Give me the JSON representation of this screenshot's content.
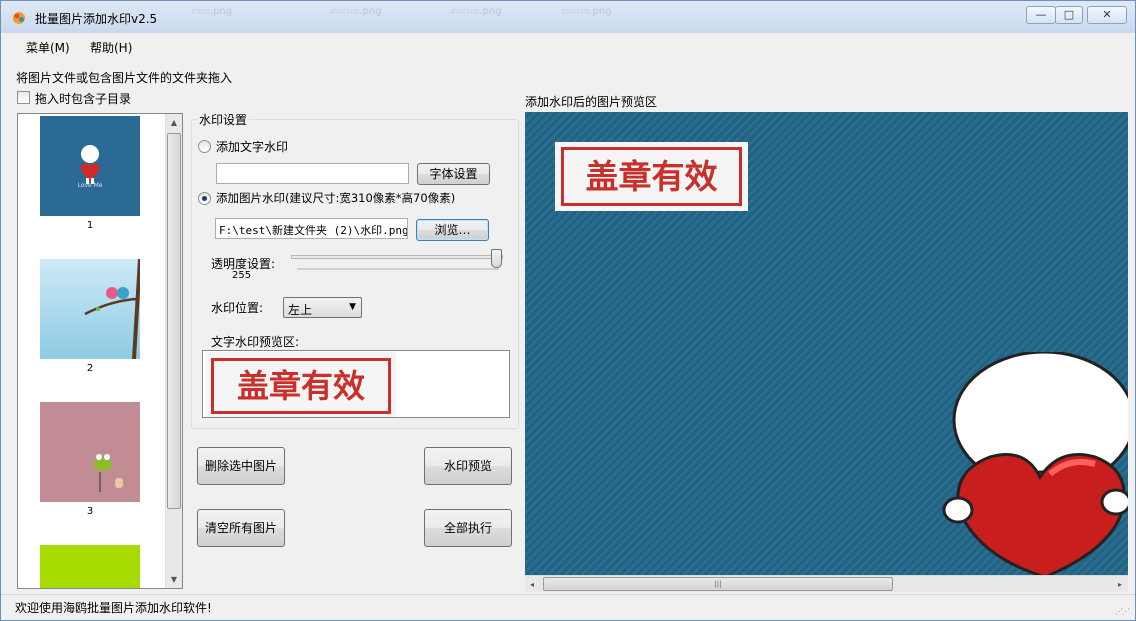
{
  "window": {
    "title": "批量图片添加水印v2.5",
    "controls": {
      "minimize": "—",
      "maximize": "□",
      "close": "✕"
    }
  },
  "menu": {
    "items": [
      "菜单(M)",
      "帮助(H)"
    ]
  },
  "left": {
    "drop_hint": "将图片文件或包含图片文件的文件夹拖入",
    "include_subdirs_label": "拖入时包含子目录",
    "include_subdirs_checked": false,
    "thumbnails": [
      {
        "number": "1",
        "caption": "Love Me",
        "bg": "#2a6a94"
      },
      {
        "number": "2",
        "bg": "#9fd3ea"
      },
      {
        "number": "3",
        "bg": "#c18c94"
      },
      {
        "number": "",
        "bg": "#a8dc00"
      }
    ]
  },
  "watermark_settings": {
    "group_title": "水印设置",
    "text_watermark_label": "添加文字水印",
    "text_watermark_checked": false,
    "text_input_value": "",
    "font_settings_button": "字体设置",
    "image_watermark_label": "添加图片水印(建议尺寸:宽310像素*高70像素)",
    "image_watermark_checked": true,
    "image_path": "F:\\test\\新建文件夹 (2)\\水印.png",
    "browse_button": "浏览…",
    "opacity_label": "透明度设置:",
    "opacity_value": "255",
    "opacity_max": "255",
    "position_label": "水印位置:",
    "position_value": "左上",
    "preview_label": "文字水印预览区:",
    "stamp_text": "盖章有效"
  },
  "actions": {
    "delete_selected": "删除选中图片",
    "preview": "水印预览",
    "clear_all": "清空所有图片",
    "execute_all": "全部执行"
  },
  "right": {
    "preview_title": "添加水印后的图片预览区",
    "stamp_text": "盖章有效"
  },
  "status": {
    "text": "欢迎使用海鸥批量图片添加水印软件!"
  }
}
